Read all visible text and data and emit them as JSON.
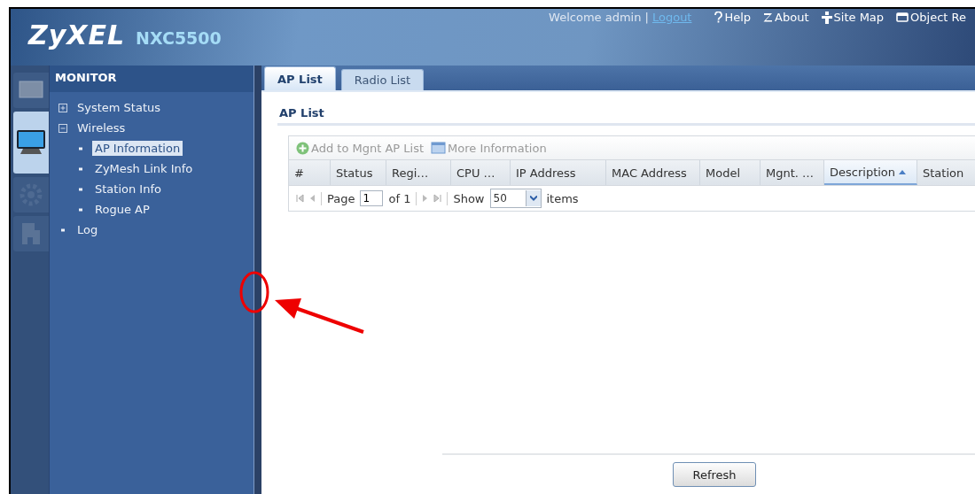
{
  "header": {
    "logo": "ZyXEL",
    "model": "NXC5500",
    "welcome": "Welcome admin |",
    "logout": "Logout",
    "links": [
      {
        "kind": "help",
        "label": "Help"
      },
      {
        "kind": "about",
        "label": "About"
      },
      {
        "kind": "sitemap",
        "label": "Site Map"
      },
      {
        "kind": "object",
        "label": "Object Re"
      }
    ]
  },
  "rail": [
    {
      "kind": "dashboard",
      "selected": false
    },
    {
      "kind": "monitor",
      "selected": true
    },
    {
      "kind": "configuration",
      "selected": false
    },
    {
      "kind": "maintenance",
      "selected": false
    }
  ],
  "sidebar": {
    "title": "MONITOR",
    "items": [
      {
        "label": "System Status",
        "expanded": false,
        "selected": false
      },
      {
        "label": "Wireless",
        "expanded": true,
        "selected": false,
        "children": [
          {
            "label": "AP Information",
            "selected": true
          },
          {
            "label": "ZyMesh Link Info",
            "selected": false
          },
          {
            "label": "Station Info",
            "selected": false
          },
          {
            "label": "Rogue AP",
            "selected": false
          }
        ]
      },
      {
        "label": "Log",
        "selected": false
      }
    ]
  },
  "tabs": [
    {
      "label": "AP List",
      "selected": true
    },
    {
      "label": "Radio List",
      "selected": false
    }
  ],
  "section_title": "AP List",
  "toolbar": [
    {
      "kind": "add",
      "label": "Add to Mgnt AP List",
      "disabled": true
    },
    {
      "kind": "info",
      "label": "More Information",
      "disabled": true
    }
  ],
  "table": {
    "columns": [
      {
        "label": "#",
        "selected": false
      },
      {
        "label": "Status",
        "selected": false
      },
      {
        "label": "Regi…",
        "selected": false
      },
      {
        "label": "CPU …",
        "selected": false
      },
      {
        "label": "IP Address",
        "selected": false
      },
      {
        "label": "MAC Address",
        "selected": false
      },
      {
        "label": "Model",
        "selected": false
      },
      {
        "label": "Mgnt. …",
        "selected": false
      },
      {
        "label": "Description",
        "selected": true
      },
      {
        "label": "Station",
        "selected": false
      }
    ]
  },
  "pager": {
    "page_label": "Page",
    "page": "1",
    "of": "of 1",
    "show_label": "Show",
    "show": "50",
    "items_label": "items"
  },
  "buttons": [
    "Refresh"
  ]
}
